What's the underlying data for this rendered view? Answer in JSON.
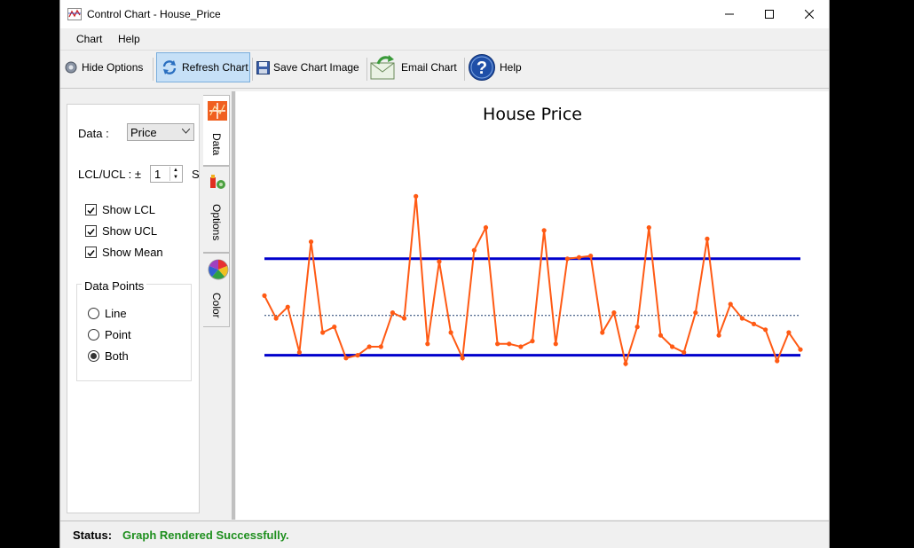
{
  "window": {
    "title": "Control Chart - House_Price",
    "controls": {
      "minimize": "minimize",
      "maximize": "maximize",
      "close": "close"
    }
  },
  "menu": {
    "items": [
      "Chart",
      "Help"
    ]
  },
  "toolbar": {
    "hide_options": "Hide Options",
    "refresh_chart": "Refresh Chart",
    "save_chart_image": "Save  Chart Image",
    "email_chart": "Email Chart",
    "help": "Help"
  },
  "options": {
    "data_label": "Data :",
    "data_selected": "Price",
    "lcl_ucl_label": "LCL/UCL : ±",
    "lcl_ucl_value": "1",
    "lcl_ucl_unit": "S",
    "checkboxes": [
      {
        "label": "Show LCL",
        "checked": true
      },
      {
        "label": "Show UCL",
        "checked": true
      },
      {
        "label": "Show Mean",
        "checked": true
      }
    ],
    "data_points_title": "Data Points",
    "radios": [
      {
        "label": "Line",
        "selected": false
      },
      {
        "label": "Point",
        "selected": false
      },
      {
        "label": "Both",
        "selected": true
      }
    ]
  },
  "tabs": [
    "Data",
    "Options",
    "Color"
  ],
  "status": {
    "label": "Status:",
    "text": "Graph Rendered Successfully.",
    "color": "#1e8f1e"
  },
  "colors": {
    "series": "#ff5a14",
    "limits": "#0000cc",
    "mean": "#1a3a6a",
    "accent": "#c6e0f7"
  },
  "chart_data": {
    "type": "line",
    "title": "House Price",
    "xlabel": "",
    "ylabel": "",
    "ylim": [
      0,
      100
    ],
    "grid": false,
    "legend": "none",
    "ucl": 66,
    "mean": 46,
    "lcl": 32,
    "x": [
      1,
      2,
      3,
      4,
      5,
      6,
      7,
      8,
      9,
      10,
      11,
      12,
      13,
      14,
      15,
      16,
      17,
      18,
      19,
      20,
      21,
      22,
      23,
      24,
      25,
      26,
      27,
      28,
      29,
      30,
      31,
      32,
      33,
      34,
      35,
      36,
      37,
      38,
      39,
      40,
      41,
      42,
      43,
      44,
      45,
      46,
      47,
      48
    ],
    "series": [
      {
        "values": [
          53,
          45,
          49,
          33,
          72,
          40,
          42,
          31,
          32,
          35,
          35,
          47,
          45,
          88,
          36,
          65,
          40,
          31,
          69,
          77,
          36,
          36,
          35,
          37,
          76,
          36,
          66,
          66.5,
          67,
          40,
          47,
          29,
          42,
          77,
          39,
          35,
          33,
          47,
          73,
          39,
          50,
          45,
          43,
          41,
          30,
          40,
          34
        ]
      }
    ]
  }
}
